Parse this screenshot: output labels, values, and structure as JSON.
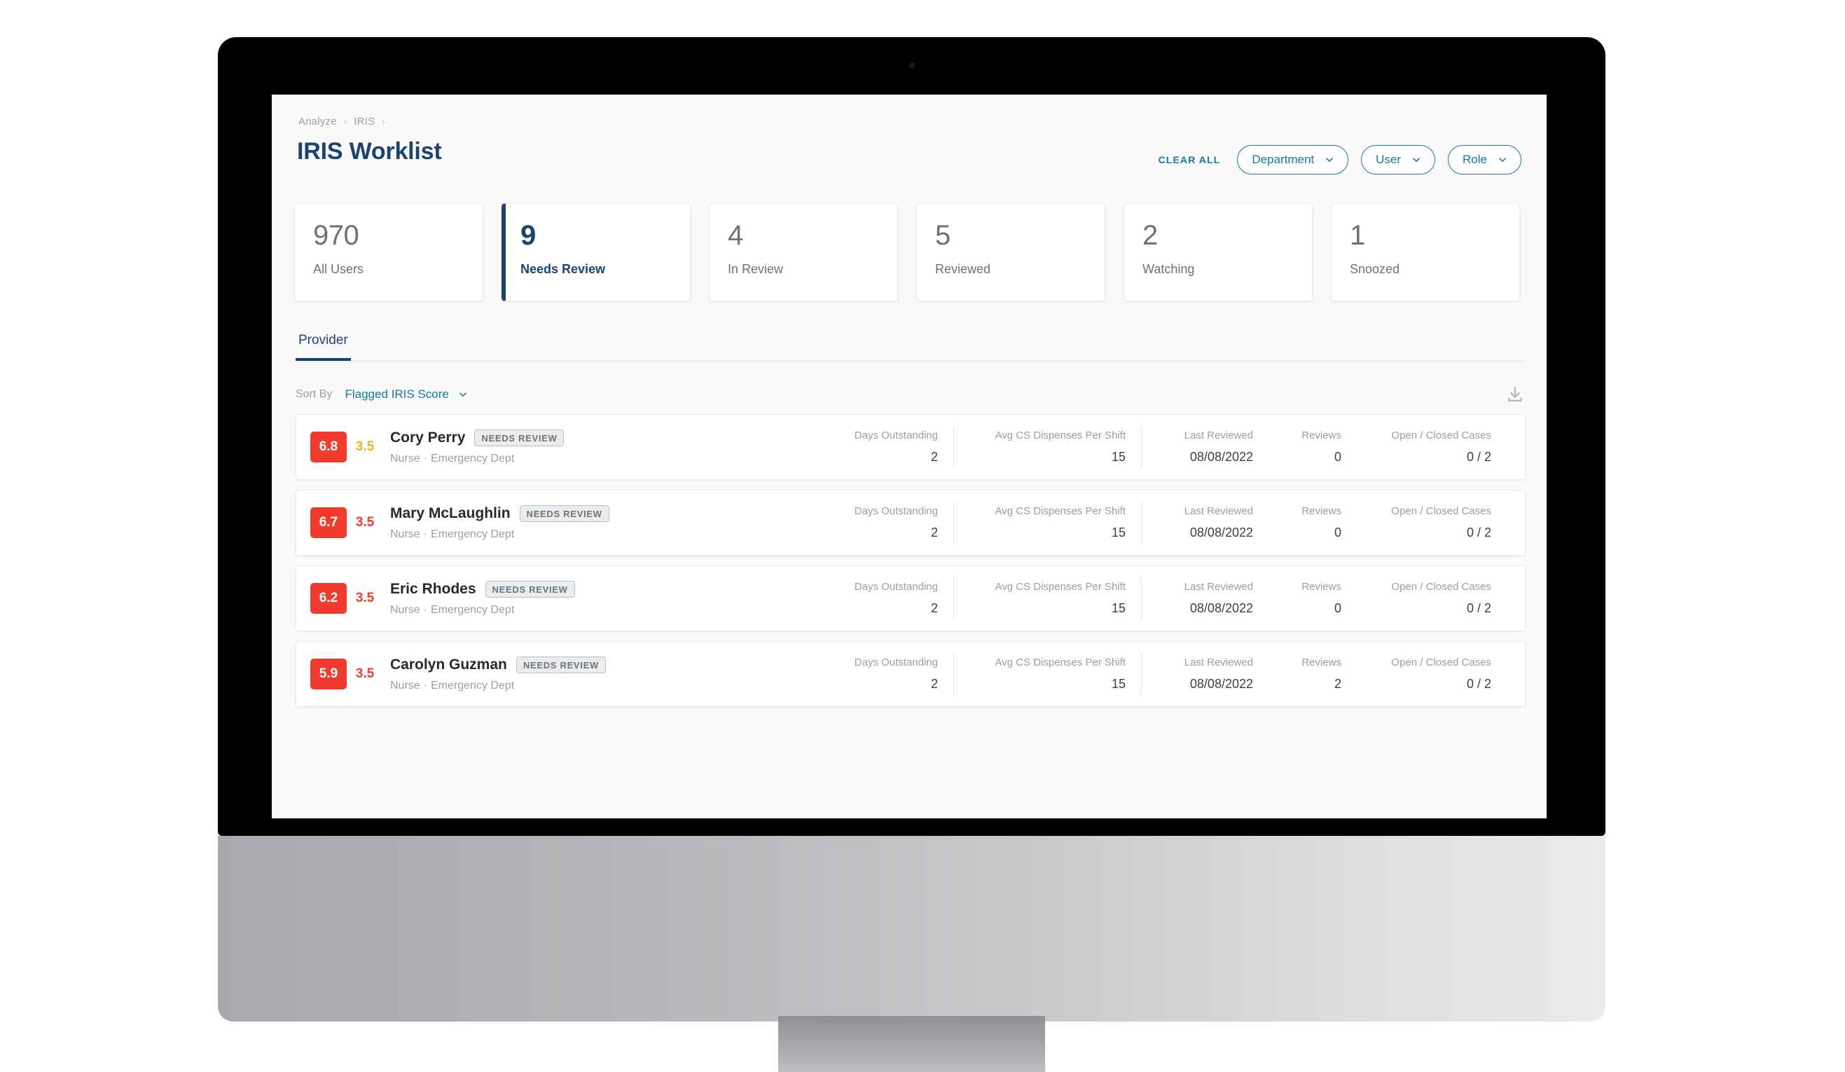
{
  "breadcrumb": {
    "items": [
      "Analyze",
      "IRIS"
    ],
    "separator": "›"
  },
  "header": {
    "title": "IRIS Worklist",
    "clear_all": "CLEAR ALL",
    "filters": [
      {
        "label": "Department",
        "icon": "chevron-down-icon"
      },
      {
        "label": "User",
        "icon": "chevron-down-icon"
      },
      {
        "label": "Role",
        "icon": "chevron-down-icon"
      }
    ]
  },
  "stats": [
    {
      "value": "970",
      "label": "All Users",
      "active": false
    },
    {
      "value": "9",
      "label": "Needs Review",
      "active": true
    },
    {
      "value": "4",
      "label": "In Review",
      "active": false
    },
    {
      "value": "5",
      "label": "Reviewed",
      "active": false
    },
    {
      "value": "2",
      "label": "Watching",
      "active": false
    },
    {
      "value": "1",
      "label": "Snoozed",
      "active": false
    }
  ],
  "tabs": [
    {
      "label": "Provider",
      "active": true
    }
  ],
  "sort": {
    "label": "Sort By",
    "value": "Flagged IRIS Score",
    "caret_icon": "chevron-down-icon",
    "download_icon": "download-icon"
  },
  "columns": {
    "days_outstanding": "Days Outstanding",
    "avg_cs": "Avg CS Dispenses Per Shift",
    "last_reviewed": "Last Reviewed",
    "reviews": "Reviews",
    "open_closed": "Open / Closed Cases"
  },
  "rows": [
    {
      "score": "6.8",
      "score_sub": "3.5",
      "score_sub_color": "#f0b323",
      "name": "Cory Perry",
      "status": "NEEDS REVIEW",
      "role": "Nurse",
      "dept": "Emergency Dept",
      "days_outstanding": "2",
      "avg_cs": "15",
      "last_reviewed": "08/08/2022",
      "reviews": "0",
      "open_closed": "0 / 2"
    },
    {
      "score": "6.7",
      "score_sub": "3.5",
      "score_sub_color": "#f13b2f",
      "name": "Mary McLaughlin",
      "status": "NEEDS REVIEW",
      "role": "Nurse",
      "dept": "Emergency Dept",
      "days_outstanding": "2",
      "avg_cs": "15",
      "last_reviewed": "08/08/2022",
      "reviews": "0",
      "open_closed": "0 / 2"
    },
    {
      "score": "6.2",
      "score_sub": "3.5",
      "score_sub_color": "#f13b2f",
      "name": "Eric Rhodes",
      "status": "NEEDS REVIEW",
      "role": "Nurse",
      "dept": "Emergency Dept",
      "days_outstanding": "2",
      "avg_cs": "15",
      "last_reviewed": "08/08/2022",
      "reviews": "0",
      "open_closed": "0 / 2"
    },
    {
      "score": "5.9",
      "score_sub": "3.5",
      "score_sub_color": "#f13b2f",
      "name": "Carolyn Guzman",
      "status": "NEEDS REVIEW",
      "role": "Nurse",
      "dept": "Emergency Dept",
      "days_outstanding": "2",
      "avg_cs": "15",
      "last_reviewed": "08/08/2022",
      "reviews": "2",
      "open_closed": "0 / 2"
    }
  ],
  "colors": {
    "brand_navy": "#1b4470",
    "accent_teal": "#0d7ea0",
    "score_red": "#f13b2f",
    "score_amber": "#f0b323",
    "muted": "#9a9da1"
  }
}
